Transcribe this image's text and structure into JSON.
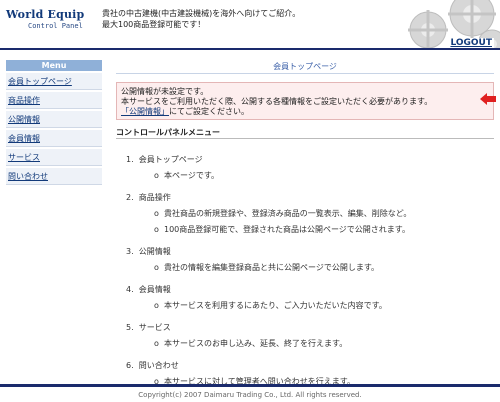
{
  "header": {
    "logo_brand": "World Equip",
    "logo_sub": "Control Panel",
    "tagline_1": "貴社の中古建機(中古建設機械)を海外へ向けてご紹介。",
    "tagline_2": "最大100商品登録可能です！",
    "logout_label": "LOGOUT"
  },
  "sidebar": {
    "heading": "Menu",
    "items": [
      {
        "label": "会員トップページ"
      },
      {
        "label": "商品操作"
      },
      {
        "label": "公開情報"
      },
      {
        "label": "会員情報"
      },
      {
        "label": "サービス"
      },
      {
        "label": "問い合わせ"
      }
    ]
  },
  "main": {
    "page_title": "会員トップページ",
    "alert_line1": "公開情報が未設定です。",
    "alert_line2": "本サービスをご利用いただく際、公開する各種情報をご設定いただく必要があります。",
    "alert_link": "「公開情報」",
    "alert_line3": "にてご設定ください。",
    "section_head": "コントロールパネルメニュー",
    "menu": [
      {
        "num": "1.",
        "title": "会員トップページ",
        "descs": [
          "本ページです。"
        ]
      },
      {
        "num": "2.",
        "title": "商品操作",
        "descs": [
          "貴社商品の新規登録や、登録済み商品の一覧表示、編集、削除など。",
          "100商品登録可能で、登録された商品は公開ページで公開されます。"
        ]
      },
      {
        "num": "3.",
        "title": "公開情報",
        "descs": [
          "貴社の情報を編集登録商品と共に公開ページで公開します。"
        ]
      },
      {
        "num": "4.",
        "title": "会員情報",
        "descs": [
          "本サービスを利用するにあたり、ご入力いただいた内容です。"
        ]
      },
      {
        "num": "5.",
        "title": "サービス",
        "descs": [
          "本サービスのお申し込み、延長、終了を行えます。"
        ]
      },
      {
        "num": "6.",
        "title": "問い合わせ",
        "descs": [
          "本サービスに対して管理者へ問い合わせを行えます。"
        ]
      }
    ],
    "bullet": "o"
  },
  "footer": {
    "copyright": "Copyright(c) 2007 Daimaru Trading Co., Ltd. All rights reserved."
  },
  "colors": {
    "accent": "#123a7a",
    "alert_bg": "#fdeeee",
    "arrow": "#e02020",
    "menu_head": "#8fb0d8"
  }
}
